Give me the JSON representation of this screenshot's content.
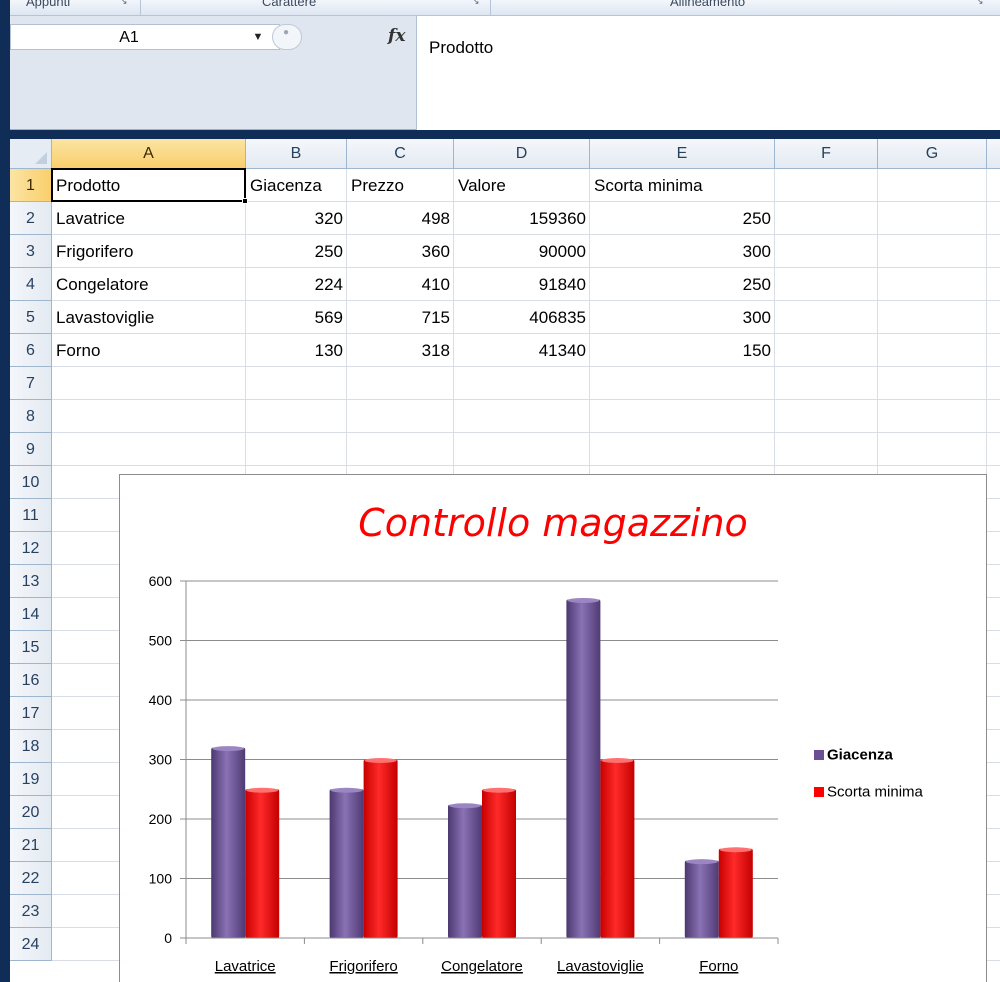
{
  "ribbon": {
    "groups": [
      "Appunti",
      "Carattere",
      "Allineamento"
    ]
  },
  "formula_bar": {
    "name_box": "A1",
    "fx_label": "fx",
    "formula": "Prodotto"
  },
  "sheet": {
    "columns": [
      "A",
      "B",
      "C",
      "D",
      "E",
      "F",
      "G"
    ],
    "rows": [
      "1",
      "2",
      "3",
      "4",
      "5",
      "6",
      "7",
      "8",
      "9",
      "10",
      "11",
      "12",
      "13",
      "14",
      "15",
      "16",
      "17",
      "18",
      "19",
      "20",
      "21",
      "22",
      "23",
      "24"
    ],
    "headers": [
      "Prodotto",
      "Giacenza",
      "Prezzo",
      "Valore",
      "Scorta minima"
    ],
    "data": [
      [
        "Lavatrice",
        "320",
        "498",
        "159360",
        "250"
      ],
      [
        "Frigorifero",
        "250",
        "360",
        "90000",
        "300"
      ],
      [
        "Congelatore",
        "224",
        "410",
        "91840",
        "250"
      ],
      [
        "Lavastoviglie",
        "569",
        "715",
        "406835",
        "300"
      ],
      [
        "Forno",
        "130",
        "318",
        "41340",
        "150"
      ]
    ],
    "active_cell": "A1"
  },
  "colors": {
    "giacenza": "#6a4f96",
    "scorta": "#ff0000",
    "title": "#ff0000",
    "selection_header": "#f9cf6b"
  },
  "chart_data": {
    "type": "bar",
    "title": "Controllo magazzino",
    "categories": [
      "Lavatrice",
      "Frigorifero",
      "Congelatore",
      "Lavastoviglie",
      "Forno"
    ],
    "series": [
      {
        "name": "Giacenza",
        "values": [
          320,
          250,
          224,
          569,
          130
        ]
      },
      {
        "name": "Scorta minima",
        "values": [
          250,
          300,
          250,
          300,
          150
        ]
      }
    ],
    "ylim": [
      0,
      600
    ],
    "yticks": [
      "0",
      "100",
      "200",
      "300",
      "400",
      "500",
      "600"
    ],
    "grid": true,
    "legend": "right"
  }
}
